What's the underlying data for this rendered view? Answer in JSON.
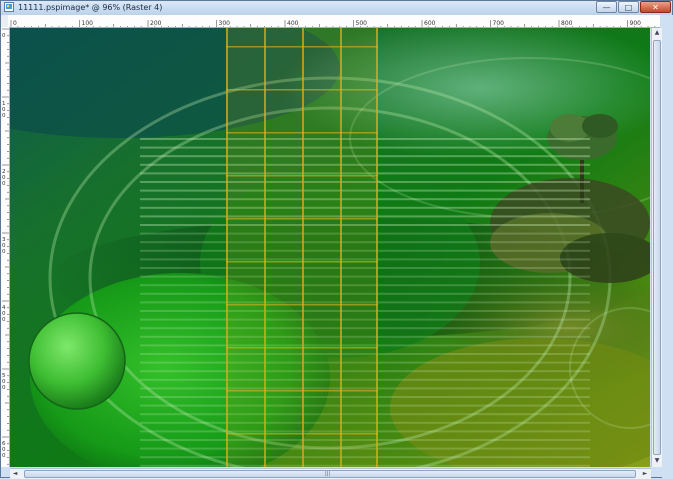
{
  "window": {
    "title": "11111.pspimage* @ 96% (Raster 4)",
    "minimize_glyph": "—",
    "maximize_glyph": "□",
    "close_glyph": "✕"
  },
  "ruler_top": {
    "labels": [
      "0",
      "100",
      "200",
      "300",
      "400",
      "500",
      "600",
      "700",
      "800",
      "900"
    ]
  },
  "ruler_left": {
    "labels": [
      "0",
      "100",
      "200",
      "300",
      "400",
      "500",
      "600"
    ]
  },
  "scrollbars": {
    "up_arrow": "▲",
    "down_arrow": "▼",
    "left_arrow": "◄",
    "right_arrow": "►",
    "grip": "|||"
  },
  "colors": {
    "canvas_base": "#0f6a1a",
    "grid_line": "#e0b020",
    "ball": "#4fd24a"
  }
}
